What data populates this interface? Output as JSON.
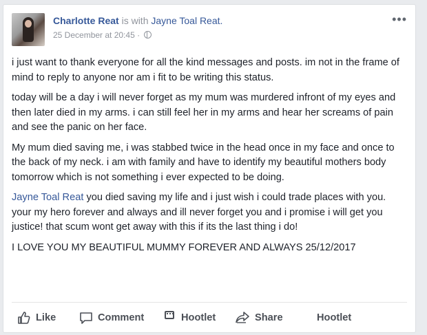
{
  "post": {
    "author": "Charlotte Reat",
    "with_text": "is with",
    "tagged": "Jayne Toal Reat.",
    "timestamp": "25 December at 20:45",
    "separator": "·",
    "more_label": "•••"
  },
  "content": {
    "p1": "i just want to thank everyone for all the kind messages and posts. im not in the frame of mind to reply to anyone nor am i fit to be writing this status.",
    "p2": "today will be a day i will never forget as my mum was murdered infront of my eyes and then later died in my arms. i can still feel her in my arms and hear her screams of pain and see the panic on her face.",
    "p3": "My mum died saving me, i was stabbed twice in the head once in my face and once to the back of my neck. i am with family and have to identify my beautiful mothers body tomorrow which is not something i ever expected to be doing.",
    "p4_mention": "Jayne Toal Reat",
    "p4_rest": " you died saving my life and i just wish i could trade places with you. your my hero forever and always and ill never forget you and i promise i will get you justice! that scum wont get away with this if its the last thing i do!",
    "p5": "I LOVE YOU MY BEAUTIFUL MUMMY FOREVER AND ALWAYS 25/12/2017"
  },
  "actions": {
    "like": "Like",
    "comment": "Comment",
    "hootlet1": "Hootlet",
    "share": "Share",
    "hootlet2": "Hootlet"
  },
  "icons": {
    "like": "thumbs-up-icon",
    "comment": "speech-bubble-icon",
    "hootlet": "hootlet-owl-icon",
    "share": "share-arrow-icon",
    "privacy": "globe-icon"
  },
  "colors": {
    "link": "#365899",
    "text": "#1d2129",
    "meta": "#90949c",
    "action": "#4b4f56"
  }
}
